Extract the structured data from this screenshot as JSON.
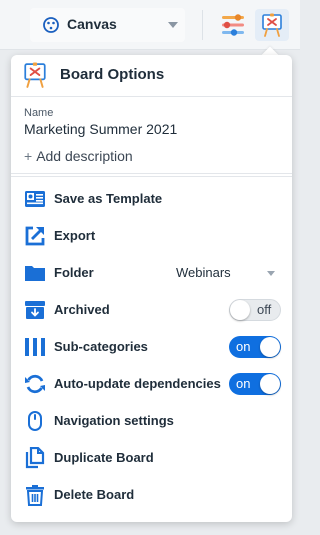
{
  "topbar": {
    "workspace_label": "Canvas",
    "icons": [
      "palette-icon",
      "sliders-icon",
      "board-icon"
    ]
  },
  "panel": {
    "title": "Board Options",
    "name_label": "Name",
    "name_value": "Marketing Summer 2021",
    "add_description": "Add description",
    "items": [
      {
        "label": "Save as Template",
        "icon": "template-icon"
      },
      {
        "label": "Export",
        "icon": "export-icon"
      },
      {
        "label": "Folder",
        "icon": "folder-icon",
        "value": "Webinars"
      },
      {
        "label": "Archived",
        "icon": "archive-icon",
        "toggle": "off"
      },
      {
        "label": "Sub-categories",
        "icon": "columns-icon",
        "toggle": "on"
      },
      {
        "label": "Auto-update dependencies",
        "icon": "sync-icon",
        "toggle": "on"
      },
      {
        "label": "Navigation settings",
        "icon": "mouse-icon"
      },
      {
        "label": "Duplicate Board",
        "icon": "copy-icon"
      },
      {
        "label": "Delete Board",
        "icon": "trash-icon"
      }
    ]
  },
  "colors": {
    "accent": "#0f6fe0",
    "text": "#1f2d3a"
  }
}
